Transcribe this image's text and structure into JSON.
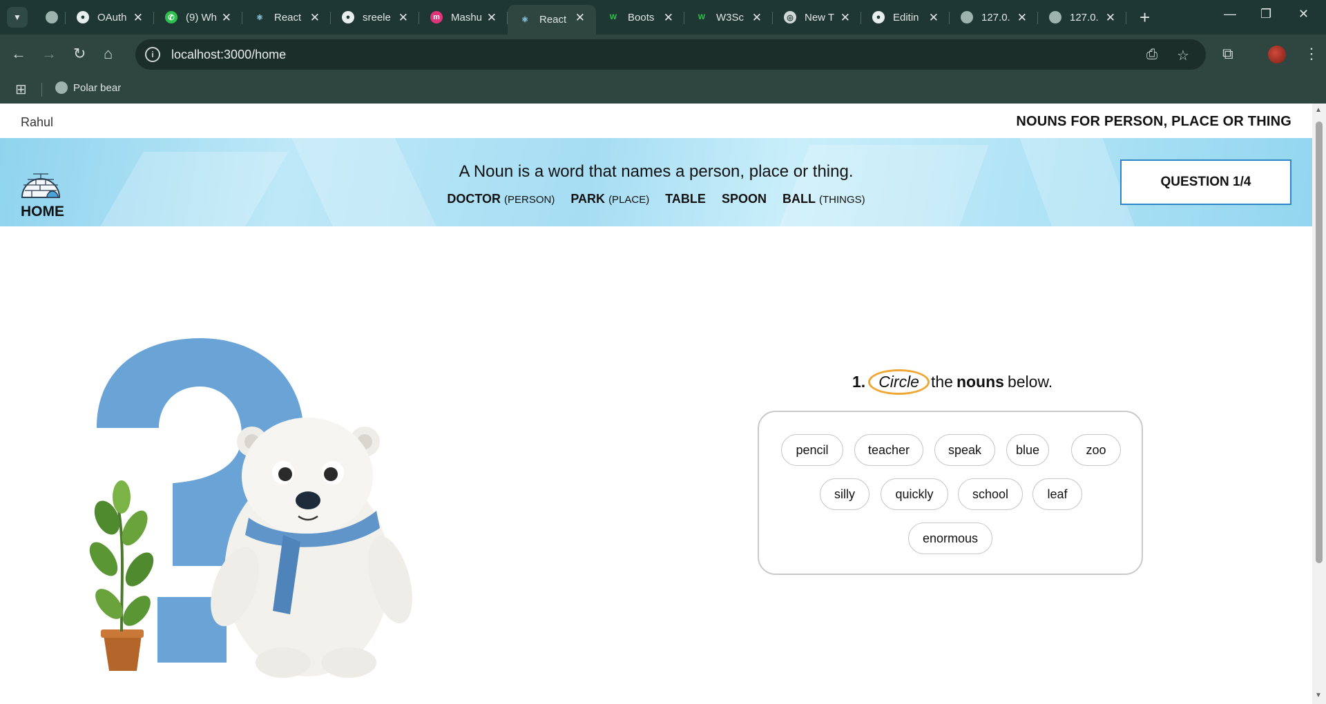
{
  "browser": {
    "tabs": [
      {
        "title": "",
        "icon": "globe-icon"
      },
      {
        "title": "OAuth",
        "icon": "github-icon"
      },
      {
        "title": "(9) Wh",
        "icon": "whatsapp-icon"
      },
      {
        "title": "React",
        "icon": "react-icon"
      },
      {
        "title": "sreele",
        "icon": "github-icon"
      },
      {
        "title": "Mashu",
        "icon": "mashup-icon"
      },
      {
        "title": "React",
        "icon": "react-icon",
        "active": true
      },
      {
        "title": "Boots",
        "icon": "w3-icon"
      },
      {
        "title": "W3Sc",
        "icon": "w3-icon"
      },
      {
        "title": "New T",
        "icon": "chrome-icon"
      },
      {
        "title": "Editin",
        "icon": "github-icon"
      },
      {
        "title": "127.0.",
        "icon": "globe-icon"
      },
      {
        "title": "127.0.",
        "icon": "globe-icon"
      }
    ],
    "url": "localhost:3000/home",
    "bookmarks": [
      {
        "label": "Polar bear",
        "icon": "globe-icon"
      }
    ]
  },
  "page": {
    "user_name": "Rahul",
    "topic": "NOUNS FOR PERSON, PLACE OR THING",
    "home_label": "HOME",
    "definition": "A Noun is a word that names a person, place or thing.",
    "examples": [
      {
        "word": "DOCTOR",
        "note": "(PERSON)"
      },
      {
        "word": "PARK",
        "note": "(PLACE)"
      },
      {
        "word": "TABLE",
        "note": ""
      },
      {
        "word": "SPOON",
        "note": ""
      },
      {
        "word": "BALL",
        "note": "(THINGS)"
      }
    ],
    "question_counter": "QUESTION 1/4",
    "question": {
      "number": "1.",
      "circle_word": "Circle",
      "before": "the",
      "emphasis": "nouns",
      "after": "below."
    },
    "options": [
      "pencil",
      "teacher",
      "speak",
      "blue",
      "zoo",
      "silly",
      "quickly",
      "school",
      "leaf",
      "enormous"
    ]
  }
}
